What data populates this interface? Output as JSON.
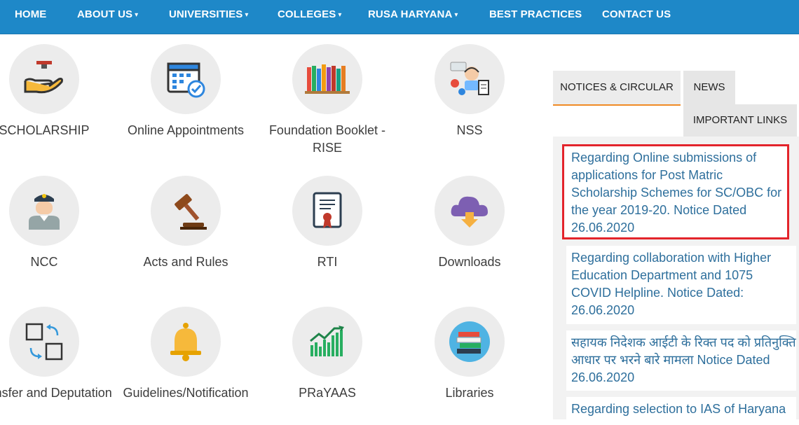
{
  "nav": {
    "items": [
      {
        "label": "HOME",
        "dropdown": false
      },
      {
        "label": "ABOUT US",
        "dropdown": true
      },
      {
        "label": "UNIVERSITIES",
        "dropdown": true
      },
      {
        "label": "COLLEGES",
        "dropdown": true
      },
      {
        "label": "RUSA HARYANA",
        "dropdown": true
      },
      {
        "label": "BEST PRACTICES",
        "dropdown": false
      },
      {
        "label": "CONTACT US",
        "dropdown": false
      }
    ],
    "caret": "▾"
  },
  "tiles": [
    {
      "label": "SCHOLARSHIP",
      "icon": "scholarship-icon"
    },
    {
      "label": "Online Appointments",
      "icon": "calendar-check-icon"
    },
    {
      "label": "Foundation Booklet - RISE",
      "icon": "books-icon"
    },
    {
      "label": "NSS",
      "icon": "support-agent-icon"
    },
    {
      "label": "NCC",
      "icon": "cadet-icon"
    },
    {
      "label": "Acts and Rules",
      "icon": "gavel-icon"
    },
    {
      "label": "RTI",
      "icon": "certificate-icon"
    },
    {
      "label": "Downloads",
      "icon": "cloud-download-icon"
    },
    {
      "label": "Transfer and Deputation",
      "icon": "transfer-icon"
    },
    {
      "label": "Guidelines/Notification",
      "icon": "bell-icon"
    },
    {
      "label": "PRaYAAS",
      "icon": "growth-chart-icon"
    },
    {
      "label": "Libraries",
      "icon": "library-icon"
    }
  ],
  "tabs": {
    "notices": "NOTICES & CIRCULAR",
    "news": "NEWS",
    "links": "IMPORTANT LINKS"
  },
  "notices": [
    {
      "text": " Regarding Online submissions of applications for Post Matric Scholarship Schemes for SC/OBC for the year 2019-20. Notice Dated 26.06.2020"
    },
    {
      "text": " Regarding collaboration with Higher Education Department and 1075 COVID Helpline. Notice Dated: 26.06.2020"
    },
    {
      "text": " सहायक निदेशक आईटी के रिक्त पद को प्रतिनुक्ति आधार पर भरने बारे मामला Notice Dated 26.06.2020"
    },
    {
      "text": " Regarding selection to IAS of Haryana"
    }
  ],
  "colors": {
    "nav_bg": "#1e88c8",
    "tab_accent": "#f08a24",
    "highlight_border": "#e3242b",
    "notice_text": "#2e6f9c"
  }
}
